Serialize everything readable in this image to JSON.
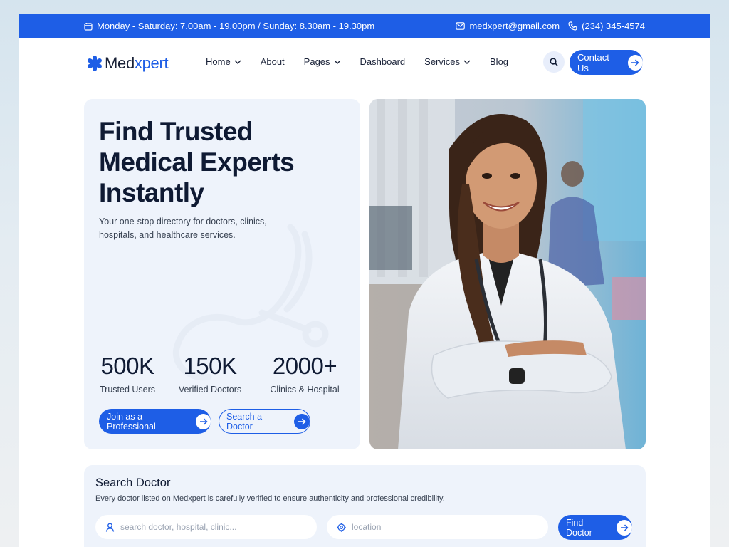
{
  "topbar": {
    "hours": "Monday - Saturday: 7.00am - 19.00pm / Sunday: 8.30am - 19.30pm",
    "email": "medxpert@gmail.com",
    "phone": "(234) 345-4574"
  },
  "brand": {
    "name_part1": "Med",
    "name_part2": "xpert"
  },
  "nav": {
    "items": [
      {
        "label": "Home",
        "dropdown": true
      },
      {
        "label": "About",
        "dropdown": false
      },
      {
        "label": "Pages",
        "dropdown": true
      },
      {
        "label": "Dashboard",
        "dropdown": false
      },
      {
        "label": "Services",
        "dropdown": true
      },
      {
        "label": "Blog",
        "dropdown": false
      }
    ],
    "contact_label": "Contact Us"
  },
  "hero": {
    "title_lines": [
      "Find Trusted",
      "Medical Experts",
      "Instantly"
    ],
    "subtitle": "Your one-stop directory for doctors, clinics, hospitals, and healthcare services.",
    "stats": [
      {
        "value": "500K",
        "label": "Trusted Users"
      },
      {
        "value": "150K",
        "label": "Verified Doctors"
      },
      {
        "value": "2000+",
        "label": "Clinics & Hospital"
      }
    ],
    "primary_button": "Join as a Professional",
    "secondary_button": "Search a Doctor"
  },
  "search": {
    "title": "Search Doctor",
    "description": "Every doctor listed on Medxpert is carefully verified to ensure authenticity and professional credibility.",
    "query_placeholder": "search doctor, hospital, clinic...",
    "location_placeholder": "location",
    "button_label": "Find Doctor"
  },
  "colors": {
    "primary": "#1e5ee6",
    "panel": "#eef3fb",
    "text_dark": "#0f1a33"
  }
}
